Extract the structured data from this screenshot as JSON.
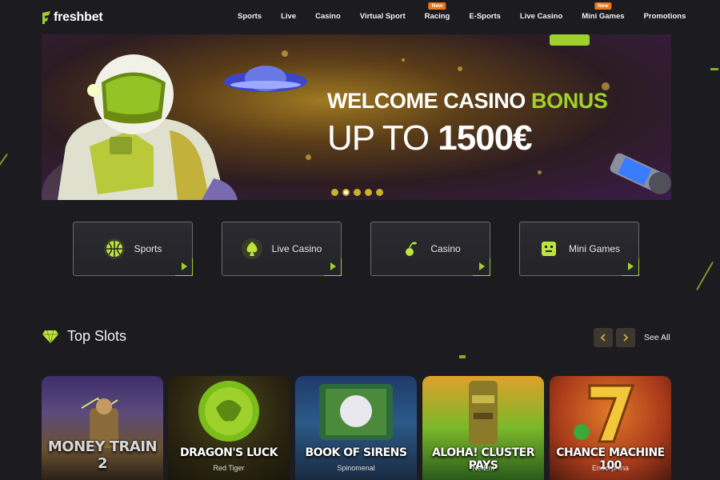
{
  "brand": {
    "name": "freshbet",
    "accent": "#9fd12c",
    "badge_color": "#e57a1f"
  },
  "nav": [
    {
      "label": "Sports",
      "badge": null
    },
    {
      "label": "Live",
      "badge": null
    },
    {
      "label": "Casino",
      "badge": null
    },
    {
      "label": "Virtual Sport",
      "badge": null
    },
    {
      "label": "Racing",
      "badge": "New"
    },
    {
      "label": "E-Sports",
      "badge": null
    },
    {
      "label": "Live Casino",
      "badge": null
    },
    {
      "label": "Mini Games",
      "badge": "New"
    },
    {
      "label": "Promotions",
      "badge": null
    }
  ],
  "banner": {
    "title_prefix": "WELCOME CASINO ",
    "title_accent": "BONUS",
    "sub_prefix": "UP TO ",
    "sub_amount": "1500€",
    "slide_count": 5,
    "active_slide": 2
  },
  "categories": [
    {
      "label": "Sports",
      "icon": "basketball-icon"
    },
    {
      "label": "Live Casino",
      "icon": "spade-icon"
    },
    {
      "label": "Casino",
      "icon": "cherry-icon"
    },
    {
      "label": "Mini Games",
      "icon": "game-icon"
    }
  ],
  "top_slots": {
    "title": "Top Slots",
    "see_all": "See All",
    "prev_icon": "chevron-left-icon",
    "next_icon": "chevron-right-icon",
    "games": [
      {
        "name": "MONEY TRAIN 2",
        "provider": ""
      },
      {
        "name": "DRAGON'S LUCK",
        "provider": "Red Tiger"
      },
      {
        "name": "BOOK OF SIRENS",
        "provider": "Spinomenal"
      },
      {
        "name": "ALOHA! CLUSTER PAYS",
        "provider": "NetEnt"
      },
      {
        "name": "CHANCE MACHINE 100",
        "provider": "Endorphina"
      }
    ]
  }
}
